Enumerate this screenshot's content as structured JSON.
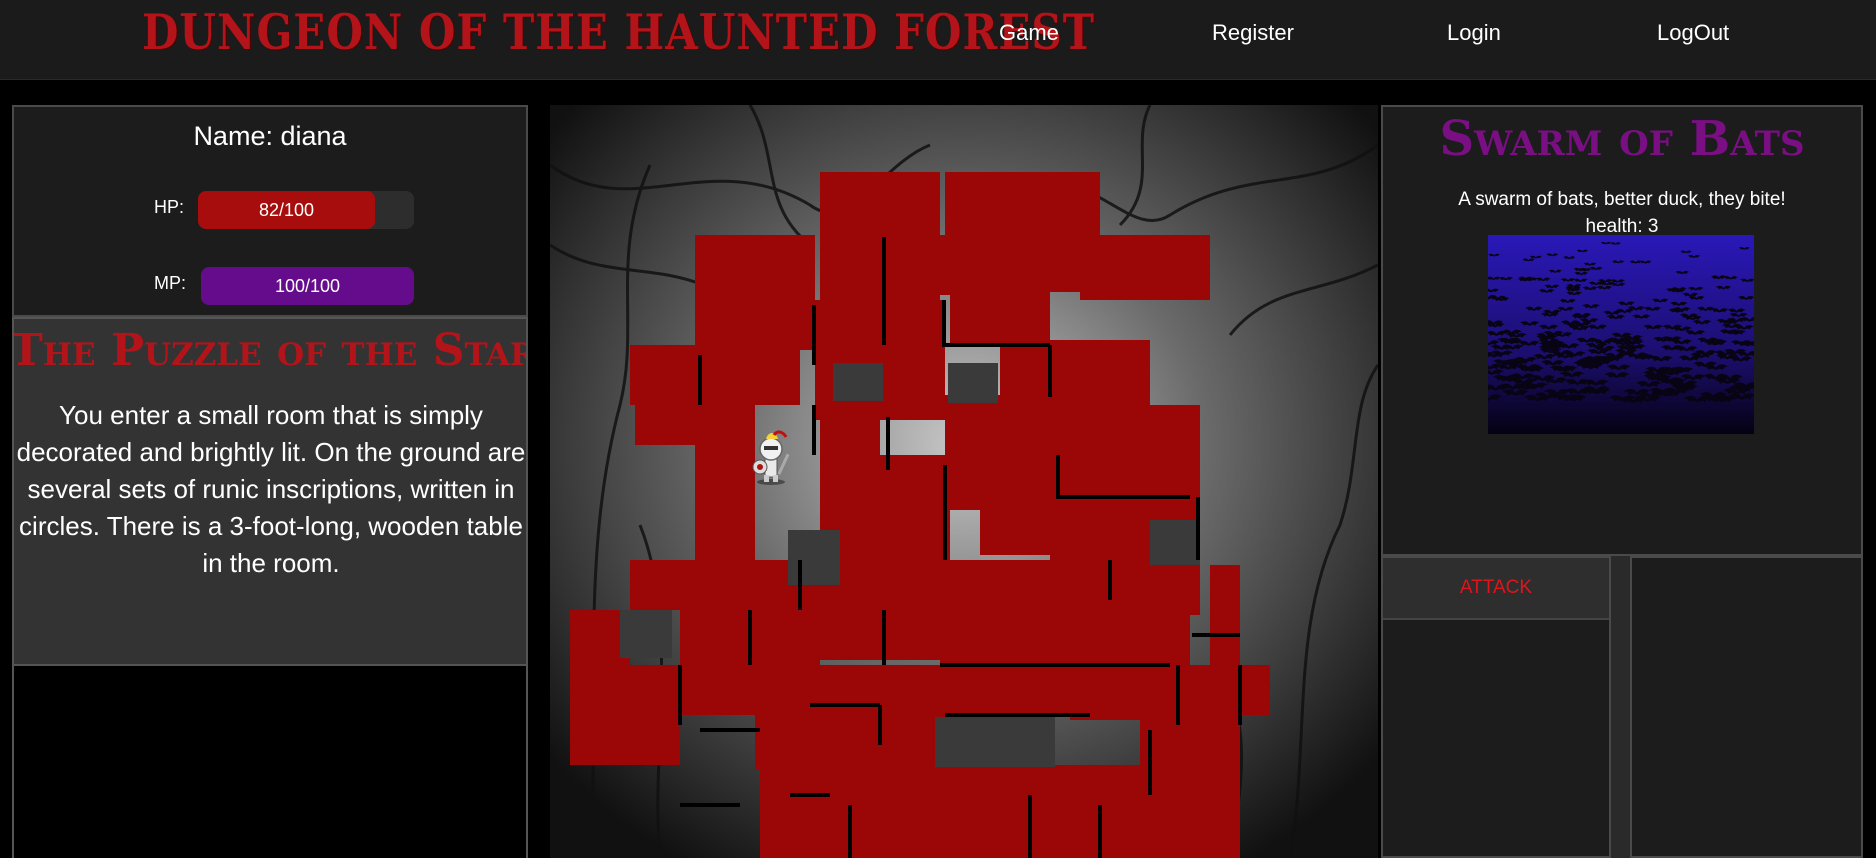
{
  "site": {
    "title": "DUNGEON OF THE HAUNTED FOREST"
  },
  "nav": {
    "game": "Game",
    "register": "Register",
    "login": "Login",
    "logout": "LogOut"
  },
  "player": {
    "name_label": "Name:",
    "name": "diana",
    "hp_label": "HP:",
    "hp_text": "82/100",
    "hp_fraction": 0.82,
    "mp_label": "MP:",
    "mp_text": "100/100",
    "mp_fraction": 1.0
  },
  "room": {
    "title": "The Puzzle of the Star",
    "description": "You enter a small room that is simply decorated and brightly lit. On the ground are several sets of runic inscriptions, written in circles. There is a 3-foot-long, wooden table in the room."
  },
  "monster": {
    "name": "Swarm of Bats",
    "description": "A swarm of bats, better duck, they bite!",
    "health_text": "health: 3",
    "image": "bat-swarm-icon"
  },
  "actions": {
    "attack_label": "ATTACK"
  },
  "colors": {
    "accent_red": "#b3141a",
    "maze_red": "#9b0606",
    "hp_bar": "#a80d0d",
    "mp_bar": "#650c8c",
    "monster_title": "#7a0f84"
  }
}
